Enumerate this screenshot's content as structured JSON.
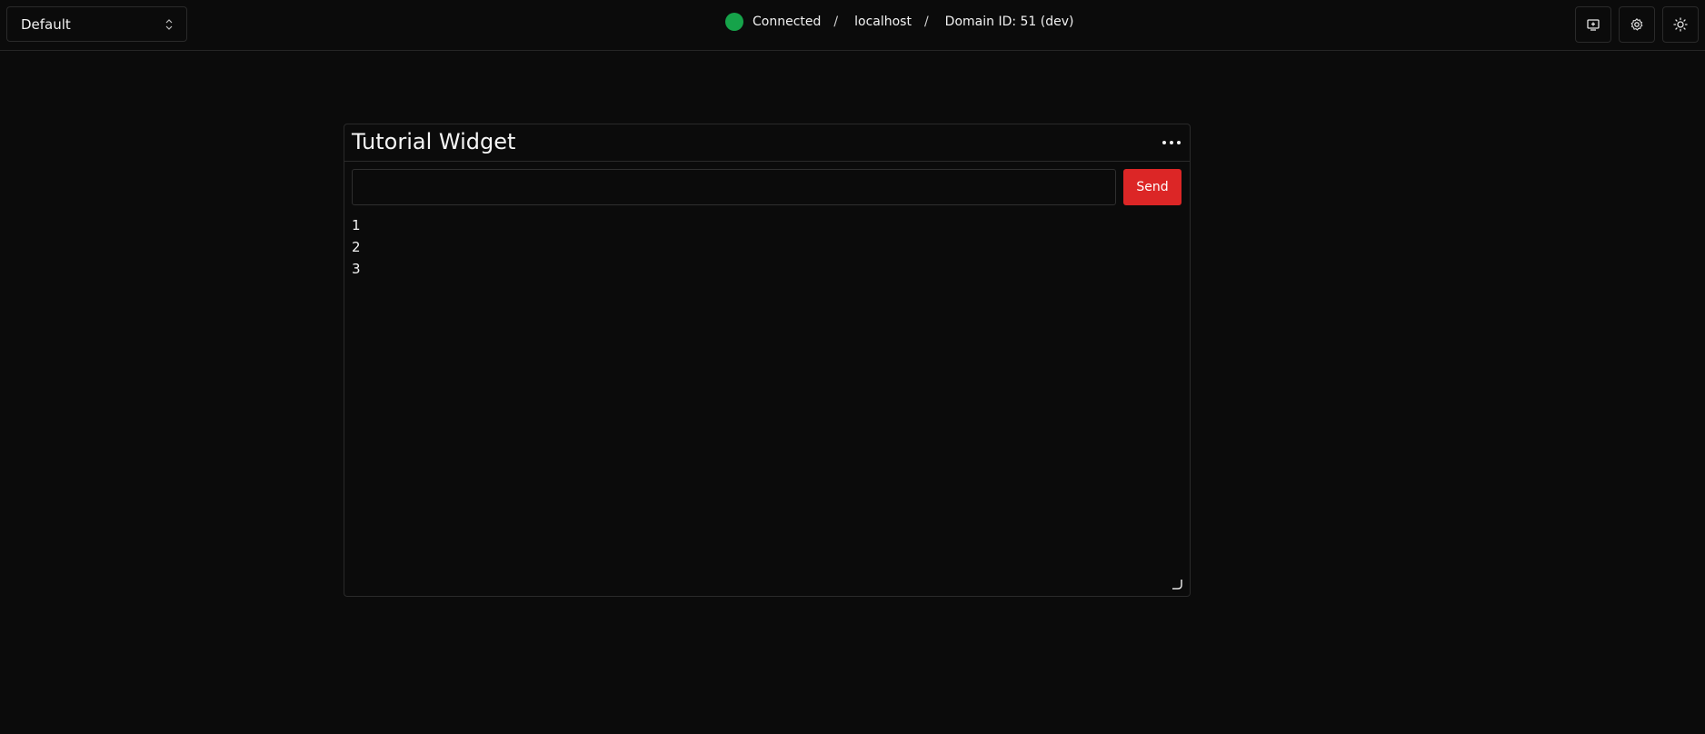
{
  "header": {
    "layout_select": {
      "value": "Default"
    },
    "connection": {
      "status": "Connected",
      "separator": "/",
      "host": "localhost",
      "domain": "Domain ID: 51 (dev)",
      "status_color": "#16a34a"
    },
    "toolbar": [
      {
        "icon": "add-widget-icon"
      },
      {
        "icon": "gear-icon"
      },
      {
        "icon": "sun-icon"
      }
    ]
  },
  "widget": {
    "title": "Tutorial Widget",
    "menu_icon": "more-horizontal-icon",
    "input": {
      "value": "",
      "placeholder": ""
    },
    "send_label": "Send",
    "send_color": "#dc2626",
    "messages": [
      "1",
      "2",
      "3"
    ]
  }
}
